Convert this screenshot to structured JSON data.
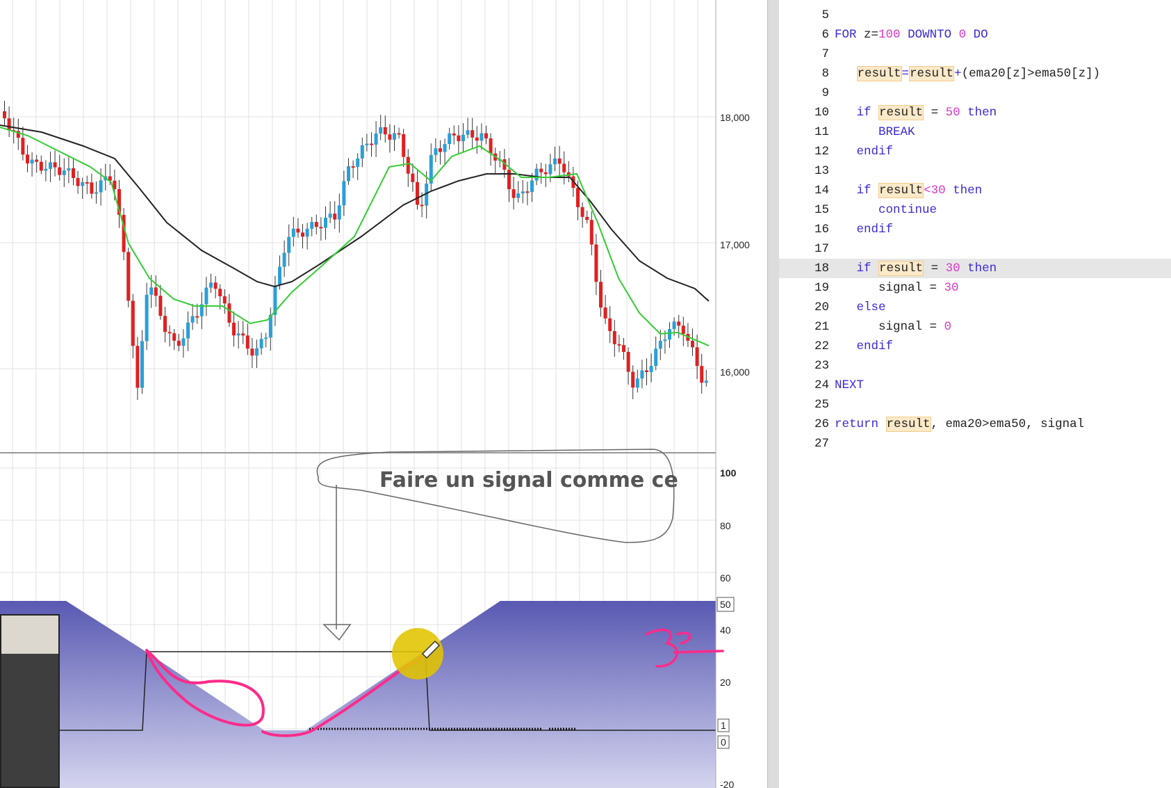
{
  "price_axis": [
    "18,000",
    "17,000",
    "16,000"
  ],
  "indicator_axis": [
    "100",
    "80",
    "60",
    "50",
    "40",
    "20",
    "1",
    "0",
    "-20"
  ],
  "annotation": {
    "text": "Faire un signal comme ce",
    "handwritten": "30"
  },
  "colors": {
    "bullish": "#2a9fd8",
    "bearish": "#e02020",
    "ema20": "#33cc33",
    "ema50": "#222222",
    "indicator_fill_top": "#5959b2",
    "indicator_fill_bottom": "#d4d4ef",
    "pen": "#ff2a8a",
    "cursor": "#e3c400"
  },
  "code": [
    {
      "n": "5",
      "t": []
    },
    {
      "n": "6",
      "t": [
        [
          "kw",
          "FOR"
        ],
        [
          "txt",
          " z="
        ],
        [
          "num",
          "100"
        ],
        [
          "txt",
          " "
        ],
        [
          "kw",
          "DOWNTO"
        ],
        [
          "txt",
          " "
        ],
        [
          "num",
          "0"
        ],
        [
          "txt",
          " "
        ],
        [
          "kw",
          "DO"
        ]
      ]
    },
    {
      "n": "7",
      "t": []
    },
    {
      "n": "8",
      "t": [
        [
          "txt",
          "   "
        ],
        [
          "var",
          "result"
        ],
        [
          "kw",
          "="
        ],
        [
          "var",
          "result"
        ],
        [
          "kw",
          "+"
        ],
        [
          "txt",
          "(ema20[z]>ema50[z])"
        ]
      ]
    },
    {
      "n": "9",
      "t": []
    },
    {
      "n": "10",
      "t": [
        [
          "txt",
          "   "
        ],
        [
          "kw",
          "if"
        ],
        [
          "txt",
          " "
        ],
        [
          "var",
          "result"
        ],
        [
          "txt",
          " = "
        ],
        [
          "num",
          "50"
        ],
        [
          "txt",
          " "
        ],
        [
          "kw",
          "then"
        ]
      ]
    },
    {
      "n": "11",
      "t": [
        [
          "txt",
          "      "
        ],
        [
          "kw",
          "BREAK"
        ]
      ]
    },
    {
      "n": "12",
      "t": [
        [
          "txt",
          "   "
        ],
        [
          "kw",
          "endif"
        ]
      ]
    },
    {
      "n": "13",
      "t": []
    },
    {
      "n": "14",
      "t": [
        [
          "txt",
          "   "
        ],
        [
          "kw",
          "if"
        ],
        [
          "txt",
          " "
        ],
        [
          "var",
          "result"
        ],
        [
          "num",
          "<30"
        ],
        [
          "txt",
          " "
        ],
        [
          "kw",
          "then"
        ]
      ]
    },
    {
      "n": "15",
      "t": [
        [
          "txt",
          "      "
        ],
        [
          "kw",
          "continue"
        ]
      ]
    },
    {
      "n": "16",
      "t": [
        [
          "txt",
          "   "
        ],
        [
          "kw",
          "endif"
        ]
      ]
    },
    {
      "n": "17",
      "t": []
    },
    {
      "n": "18",
      "t": [
        [
          "txt",
          "   "
        ],
        [
          "kw",
          "if"
        ],
        [
          "txt",
          " "
        ],
        [
          "var",
          "result"
        ],
        [
          "txt",
          " = "
        ],
        [
          "num",
          "30"
        ],
        [
          "txt",
          " "
        ],
        [
          "kw",
          "then"
        ]
      ]
    },
    {
      "n": "19",
      "t": [
        [
          "txt",
          "      signal = "
        ],
        [
          "num",
          "30"
        ]
      ]
    },
    {
      "n": "20",
      "t": [
        [
          "txt",
          "   "
        ],
        [
          "kw",
          "else"
        ]
      ]
    },
    {
      "n": "21",
      "t": [
        [
          "txt",
          "      signal = "
        ],
        [
          "num",
          "0"
        ]
      ]
    },
    {
      "n": "22",
      "t": [
        [
          "txt",
          "   "
        ],
        [
          "kw",
          "endif"
        ]
      ]
    },
    {
      "n": "23",
      "t": []
    },
    {
      "n": "24",
      "t": [
        [
          "kw",
          "NEXT"
        ]
      ]
    },
    {
      "n": "25",
      "t": []
    },
    {
      "n": "26",
      "t": [
        [
          "kw",
          "return"
        ],
        [
          "txt",
          " "
        ],
        [
          "var",
          "result"
        ],
        [
          "txt",
          ", ema20>ema50, signal"
        ]
      ]
    },
    {
      "n": "27",
      "t": []
    }
  ]
}
